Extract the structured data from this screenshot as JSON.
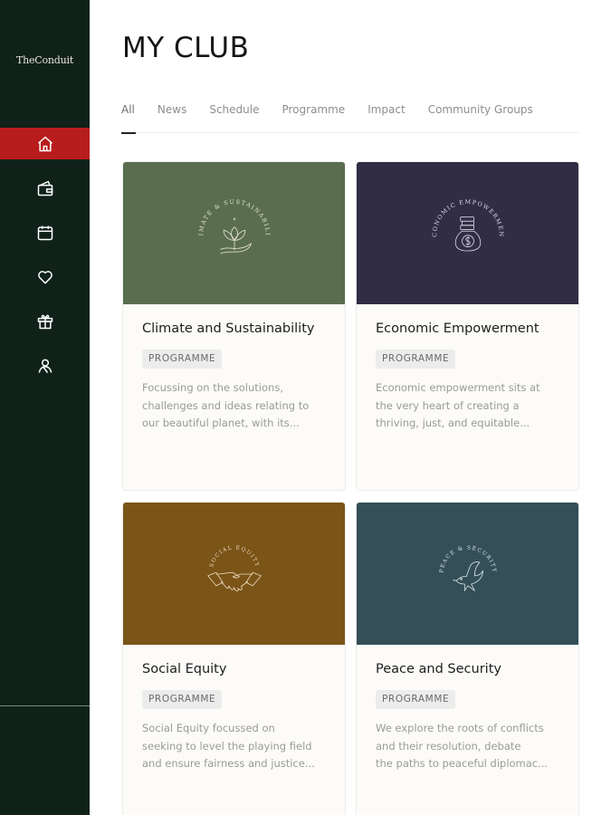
{
  "sidebar": {
    "logo": "TheConduit",
    "nav_items": [
      {
        "name": "home",
        "icon": "home-icon",
        "active": true
      },
      {
        "name": "wallet",
        "icon": "wallet-icon",
        "active": false
      },
      {
        "name": "calendar",
        "icon": "calendar-icon",
        "active": false
      },
      {
        "name": "favourites",
        "icon": "heart-icon",
        "active": false
      },
      {
        "name": "gifts",
        "icon": "gift-icon",
        "active": false
      },
      {
        "name": "members",
        "icon": "people-icon",
        "active": false
      }
    ],
    "footer_text": "",
    "active_color": "#b81d1d",
    "background_color": "#0f2119"
  },
  "page": {
    "title": "MY CLUB"
  },
  "tabs": [
    {
      "label": "All",
      "active": true
    },
    {
      "label": "News",
      "active": false
    },
    {
      "label": "Schedule",
      "active": false
    },
    {
      "label": "Programme",
      "active": false
    },
    {
      "label": "Impact",
      "active": false
    },
    {
      "label": "Community Groups",
      "active": false
    }
  ],
  "cards": [
    {
      "image_label": "CLIMATE & SUSTAINABILITY",
      "image_icon": "lotus-hand-icon",
      "image_color": "#5a6e4f",
      "title": "Climate and Sustainability",
      "badge": "PROGRAMME",
      "description_lines": [
        "Focussing on the solutions,",
        "challenges and ideas relating to",
        "our beautiful planet, with its..."
      ]
    },
    {
      "image_label": "ECONOMIC EMPOWERMENT",
      "image_icon": "money-bag-icon",
      "image_color": "#302d45",
      "title": "Economic Empowerment",
      "badge": "PROGRAMME",
      "description_lines": [
        "Economic empowerment sits at",
        "the very heart of creating a",
        "thriving, just, and equitable..."
      ]
    },
    {
      "image_label": "SOCIAL EQUITY",
      "image_icon": "handshake-icon",
      "image_color": "#7b5418",
      "title": "Social Equity",
      "badge": "PROGRAMME",
      "description_lines": [
        "Social Equity focussed on",
        "seeking to level the playing field",
        "and ensure fairness and justice..."
      ]
    },
    {
      "image_label": "PEACE & SECURITY",
      "image_icon": "dove-icon",
      "image_color": "#344f58",
      "title": "Peace and Security",
      "badge": "PROGRAMME",
      "description_lines": [
        "We explore the roots of conflicts",
        "and their resolution, debate",
        "the paths to peaceful diplomac..."
      ]
    }
  ]
}
